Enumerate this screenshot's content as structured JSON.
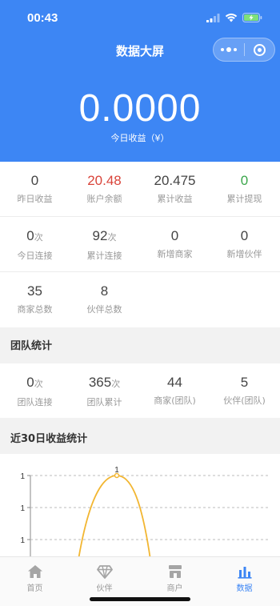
{
  "status_bar": {
    "time": "00:43"
  },
  "header": {
    "title": "数据大屏",
    "total_value": "0.0000",
    "total_label": "今日收益（¥）"
  },
  "stats": [
    [
      {
        "value": "0",
        "unit": "",
        "label": "昨日收益",
        "color": "#444444"
      },
      {
        "value": "20.48",
        "unit": "",
        "label": "账户余额",
        "color": "#d9443a"
      },
      {
        "value": "20.475",
        "unit": "",
        "label": "累计收益",
        "color": "#444444"
      },
      {
        "value": "0",
        "unit": "",
        "label": "累计提现",
        "color": "#3aa64a"
      }
    ],
    [
      {
        "value": "0",
        "unit": "次",
        "label": "今日连接",
        "color": "#444444"
      },
      {
        "value": "92",
        "unit": "次",
        "label": "累计连接",
        "color": "#444444"
      },
      {
        "value": "0",
        "unit": "",
        "label": "新增商家",
        "color": "#444444"
      },
      {
        "value": "0",
        "unit": "",
        "label": "新增伙伴",
        "color": "#444444"
      }
    ],
    [
      {
        "value": "35",
        "unit": "",
        "label": "商家总数",
        "color": "#444444"
      },
      {
        "value": "8",
        "unit": "",
        "label": "伙伴总数",
        "color": "#444444"
      }
    ]
  ],
  "team_section": {
    "title": "团队统计",
    "items": [
      {
        "value": "0",
        "unit": "次",
        "label": "团队连接"
      },
      {
        "value": "365",
        "unit": "次",
        "label": "团队累计"
      },
      {
        "value": "44",
        "unit": "",
        "label": "商家(团队)"
      },
      {
        "value": "5",
        "unit": "",
        "label": "伙伴(团队)"
      }
    ]
  },
  "chart_section": {
    "title": "近30日收益统计"
  },
  "chart_data": {
    "type": "line",
    "y_tick_labels": [
      "1",
      "1",
      "1"
    ],
    "peak_label": "1",
    "series_color": "#f2b632",
    "grid": "dashed horizontal"
  },
  "tabbar": [
    {
      "label": "首页",
      "icon": "home-icon",
      "active": false
    },
    {
      "label": "伙伴",
      "icon": "diamond-icon",
      "active": false
    },
    {
      "label": "商户",
      "icon": "store-icon",
      "active": false
    },
    {
      "label": "数据",
      "icon": "bar-chart-icon",
      "active": true
    }
  ],
  "colors": {
    "primary": "#3d86f4",
    "red": "#d9443a",
    "green": "#3aa64a"
  }
}
